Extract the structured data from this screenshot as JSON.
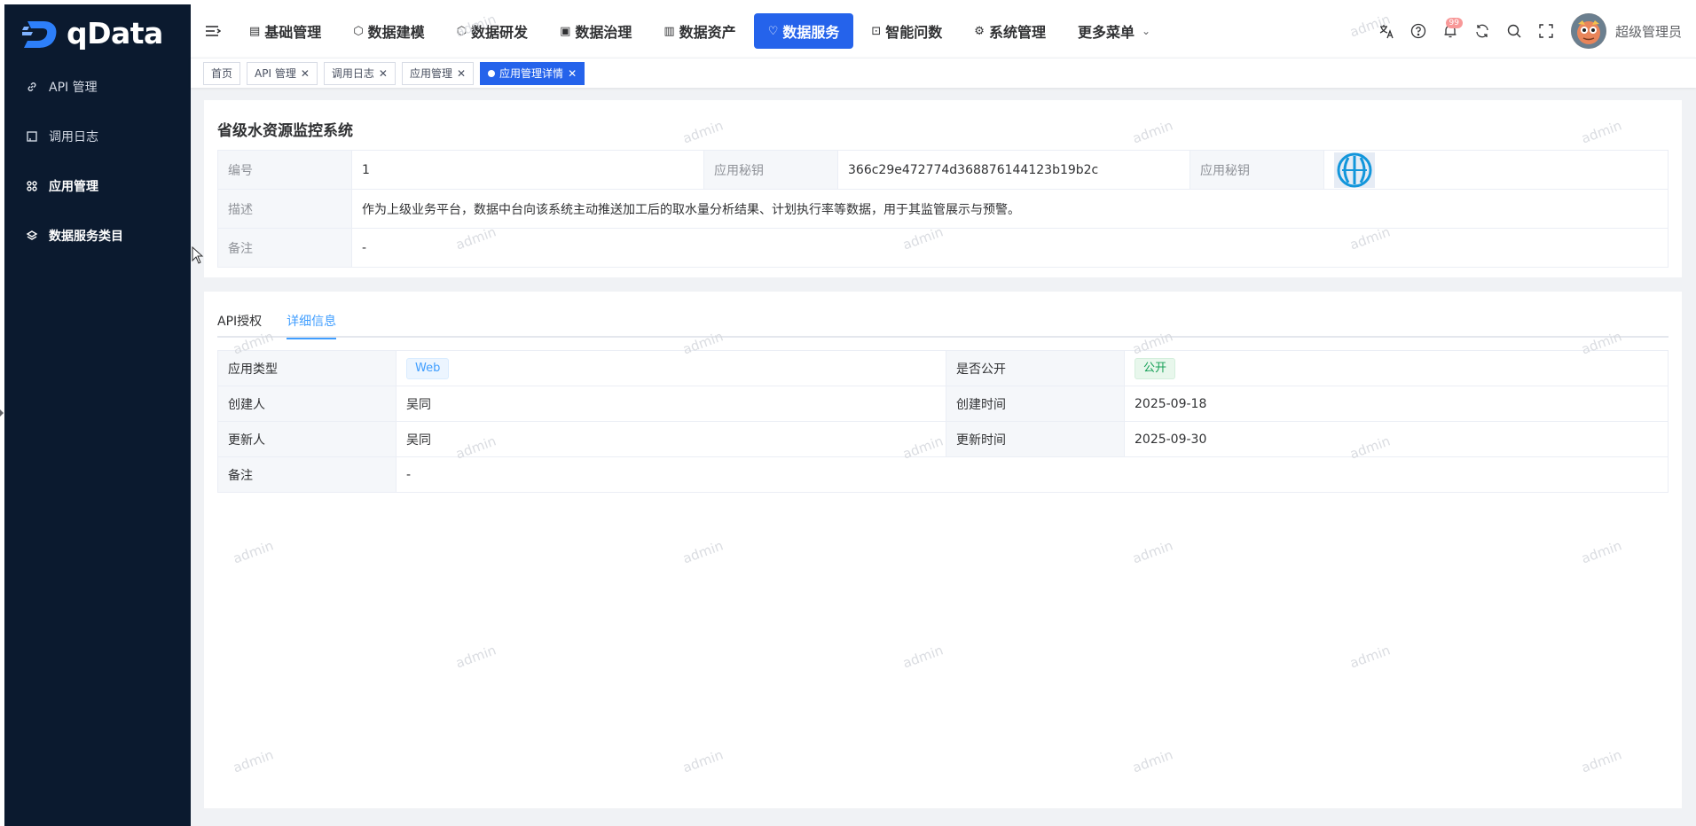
{
  "app": {
    "logo_text": "qData"
  },
  "sidebar": {
    "items": [
      {
        "label": "API 管理",
        "icon": "link-icon"
      },
      {
        "label": "调用日志",
        "icon": "log-icon"
      },
      {
        "label": "应用管理",
        "icon": "grid-icon",
        "active": true
      },
      {
        "label": "数据服务类目",
        "icon": "layers-icon"
      }
    ]
  },
  "header": {
    "nav": [
      {
        "label": "基础管理",
        "icon": "doc-icon"
      },
      {
        "label": "数据建模",
        "icon": "cube-icon"
      },
      {
        "label": "数据研发",
        "icon": "hexagon-icon"
      },
      {
        "label": "数据治理",
        "icon": "image-icon"
      },
      {
        "label": "数据资产",
        "icon": "asset-icon"
      },
      {
        "label": "数据服务",
        "icon": "heart-icon",
        "active": true
      },
      {
        "label": "智能问数",
        "icon": "robot-icon"
      },
      {
        "label": "系统管理",
        "icon": "gear-icon"
      },
      {
        "label": "更多菜单",
        "icon": "chevron-down-icon"
      }
    ],
    "notification_badge": "99",
    "username": "超级管理员"
  },
  "tags": [
    {
      "label": "首页",
      "closable": false
    },
    {
      "label": "API 管理",
      "closable": true
    },
    {
      "label": "调用日志",
      "closable": true
    },
    {
      "label": "应用管理",
      "closable": true
    },
    {
      "label": "应用管理详情",
      "closable": true,
      "active": true
    }
  ],
  "app_info": {
    "title": "省级水资源监控系统",
    "id_label": "编号",
    "id_value": "1",
    "secret_label": "应用秘钥",
    "secret_value": "366c29e472774d368876144123b19b2c",
    "icon_label": "应用秘钥",
    "desc_label": "描述",
    "desc_value": "作为上级业务平台，数据中台向该系统主动推送加工后的取水量分析结果、计划执行率等数据，用于其监管展示与预警。",
    "remark_label": "备注",
    "remark_value": "-"
  },
  "tabs": [
    {
      "label": "API授权"
    },
    {
      "label": "详细信息",
      "active": true
    }
  ],
  "details": {
    "type_label": "应用类型",
    "type_value": "Web",
    "public_label": "是否公开",
    "public_value": "公开",
    "creator_label": "创建人",
    "creator_value": "吴同",
    "created_label": "创建时间",
    "created_value": "2025-09-18",
    "updater_label": "更新人",
    "updater_value": "吴同",
    "updated_label": "更新时间",
    "updated_value": "2025-09-30",
    "remark_label": "备注",
    "remark_value": "-"
  },
  "watermark": "admin",
  "colors": {
    "primary": "#2563eb",
    "sidebar_bg": "#0b1a2f",
    "tab_active": "#409eff"
  }
}
